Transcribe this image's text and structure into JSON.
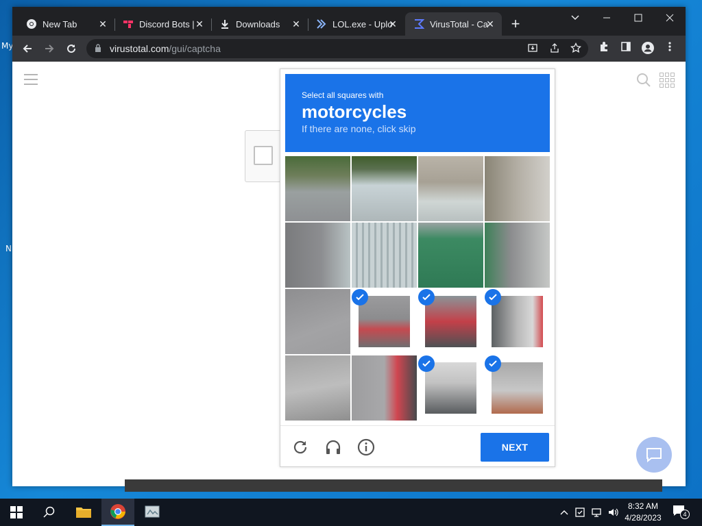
{
  "desktop": {
    "icon_labels": [
      "My",
      "N"
    ]
  },
  "browser": {
    "tabs": [
      {
        "title": "New Tab",
        "icon": "chrome-icon"
      },
      {
        "title": "Discord Bots |",
        "icon": "topgg-icon"
      },
      {
        "title": "Downloads",
        "icon": "download-icon"
      },
      {
        "title": "LOL.exe - Uplo",
        "icon": "virustotal-icon"
      },
      {
        "title": "VirusTotal - Ca",
        "icon": "virustotal-icon",
        "active": true
      }
    ],
    "url_host": "virustotal.com",
    "url_path": "/gui/captcha"
  },
  "captcha": {
    "instruction": "Select all squares with",
    "object": "motorcycles",
    "hint": "If there are none, click skip",
    "selected_tiles": [
      9,
      10,
      11,
      14,
      15
    ],
    "next_label": "NEXT",
    "accent": "#1a73e8"
  },
  "taskbar": {
    "time": "8:32 AM",
    "date": "4/28/2023",
    "notification_count": "4"
  }
}
